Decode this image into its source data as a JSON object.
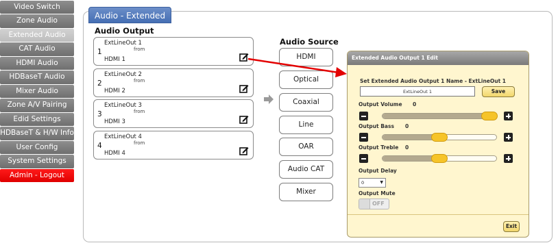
{
  "sidebar": {
    "items": [
      {
        "label": "Video Switch"
      },
      {
        "label": "Zone Audio"
      },
      {
        "label": "Extended Audio"
      },
      {
        "label": "CAT Audio"
      },
      {
        "label": "HDMI Audio"
      },
      {
        "label": "HDBaseT Audio"
      },
      {
        "label": "Mixer Audio"
      },
      {
        "label": "Zone A/V Pairing"
      },
      {
        "label": "Edid Settings"
      },
      {
        "label": "HDBaseT & H/W Info"
      },
      {
        "label": "User Config"
      },
      {
        "label": "System Settings"
      },
      {
        "label": "Admin - Logout"
      }
    ]
  },
  "page": {
    "tab_title": "Audio - Extended",
    "output_heading": "Audio Output",
    "source_heading": "Audio Source"
  },
  "outputs": [
    {
      "num": "1",
      "name": "ExtLineOut 1",
      "from": "from",
      "source": "HDMI 1"
    },
    {
      "num": "2",
      "name": "ExtLineOut 2",
      "from": "from",
      "source": "HDMI 2"
    },
    {
      "num": "3",
      "name": "ExtLineOut 3",
      "from": "from",
      "source": "HDMI 3"
    },
    {
      "num": "4",
      "name": "ExtLineOut 4",
      "from": "from",
      "source": "HDMI 4"
    }
  ],
  "sources": [
    {
      "label": "HDMI"
    },
    {
      "label": "Optical"
    },
    {
      "label": "Coaxial"
    },
    {
      "label": "Line"
    },
    {
      "label": "OAR"
    },
    {
      "label": "Audio CAT"
    },
    {
      "label": "Mixer"
    }
  ],
  "dialog": {
    "title": "Extended Audio Output 1 Edit",
    "name_label": "Set Extended Audio Output 1 Name - ExtLineOut 1",
    "name_value": "ExtLineOut 1",
    "save_label": "Save",
    "volume": {
      "label": "Output Volume",
      "value": "0",
      "level": 0.94
    },
    "bass": {
      "label": "Output Bass",
      "value": "0",
      "level": 0.5
    },
    "treble": {
      "label": "Output Treble",
      "value": "0",
      "level": 0.5
    },
    "delay": {
      "label": "Output Delay",
      "value": "0"
    },
    "mute": {
      "label": "Output Mute",
      "state": "OFF"
    },
    "exit_label": "Exit"
  },
  "colors": {
    "sidebar_bg": "#7f7f7f",
    "sidebar_active": "#c8c8c8",
    "logout": "#ff0000",
    "tab": "#4f77b8",
    "dialog_bg": "#fff6cf",
    "handle": "#f6c429",
    "arrow": "#e30000"
  },
  "icons": {
    "edit": "edit-icon",
    "source_arrow": "right-arrow-icon",
    "minus": "minus-icon",
    "plus": "plus-icon",
    "dropdown": "chevron-down-icon"
  }
}
